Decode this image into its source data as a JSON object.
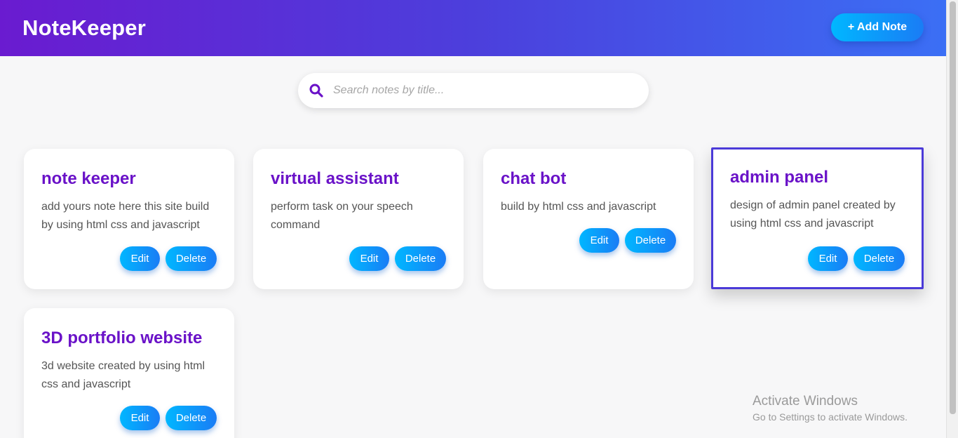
{
  "header": {
    "title": "NoteKeeper",
    "add_label": "+ Add Note"
  },
  "search": {
    "placeholder": "Search notes by title...",
    "icon": "search-icon"
  },
  "notes": [
    {
      "title": "note keeper",
      "body": "add yours note here this site build by using html css and javascript",
      "edit_label": "Edit",
      "delete_label": "Delete"
    },
    {
      "title": "virtual assistant",
      "body": "perform task on your speech command",
      "edit_label": "Edit",
      "delete_label": "Delete"
    },
    {
      "title": "chat bot",
      "body": "build by html css and javascript",
      "edit_label": "Edit",
      "delete_label": "Delete"
    },
    {
      "title": "admin panel",
      "body": "design of admin panel created by using html css and javascript",
      "edit_label": "Edit",
      "delete_label": "Delete"
    },
    {
      "title": "3D portfolio website",
      "body": "3d website created by using html css and javascript",
      "edit_label": "Edit",
      "delete_label": "Delete"
    }
  ],
  "watermark": {
    "line1": "Activate Windows",
    "line2": "Go to Settings to activate Windows."
  },
  "colors": {
    "header_start": "#6a1bd0",
    "header_end": "#3b6ff5",
    "title": "#6a12c8",
    "button_start": "#00b7ff",
    "button_end": "#1a7cf5",
    "selected_border": "#4b3ad8"
  }
}
